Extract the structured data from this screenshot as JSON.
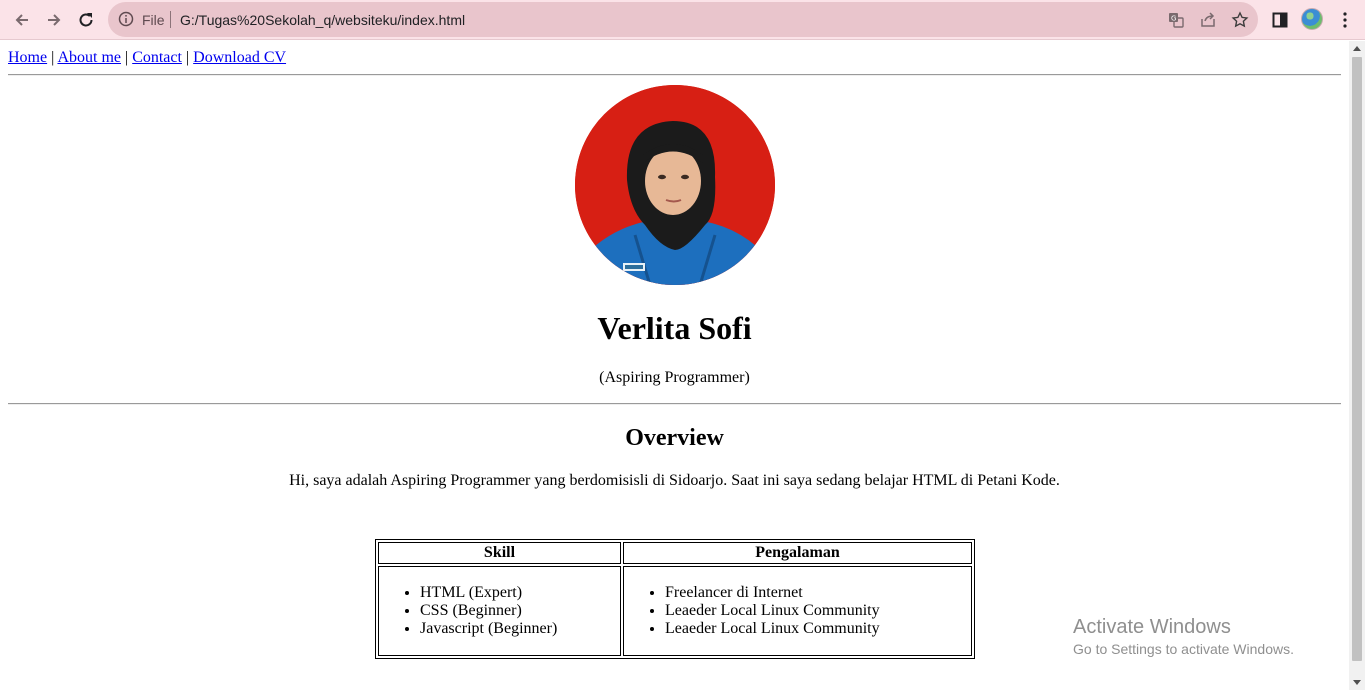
{
  "browser": {
    "omnibox_scheme": "File",
    "url": "G:/Tugas%20Sekolah_q/websiteku/index.html",
    "toolbar_color": "#fbe3e8",
    "icons": [
      "back-icon",
      "forward-icon",
      "reload-icon",
      "info-icon",
      "translate-icon",
      "share-icon",
      "bookmark-star-icon",
      "side-panel-icon",
      "profile-avatar",
      "menu-kebab-icon"
    ]
  },
  "nav": {
    "links": [
      "Home",
      "About me",
      "Contact",
      "Download CV"
    ],
    "separator": "|"
  },
  "profile": {
    "photo_background": "#d71f14",
    "name": "Verlita Sofi",
    "role": "(Aspiring Programmer)"
  },
  "overview": {
    "heading": "Overview",
    "text": "Hi, saya adalah Aspiring Programmer yang berdomisisli di Sidoarjo. Saat ini saya sedang belajar HTML di Petani Kode."
  },
  "table": {
    "headers": [
      "Skill",
      "Pengalaman"
    ],
    "skills": [
      "HTML (Expert)",
      "CSS (Beginner)",
      "Javascript (Beginner)"
    ],
    "experience": [
      "Freelancer di Internet",
      "Leaeder Local Linux Community",
      "Leaeder Local Linux Community"
    ]
  },
  "watermark": {
    "line1": "Activate Windows",
    "line2": "Go to Settings to activate Windows."
  }
}
